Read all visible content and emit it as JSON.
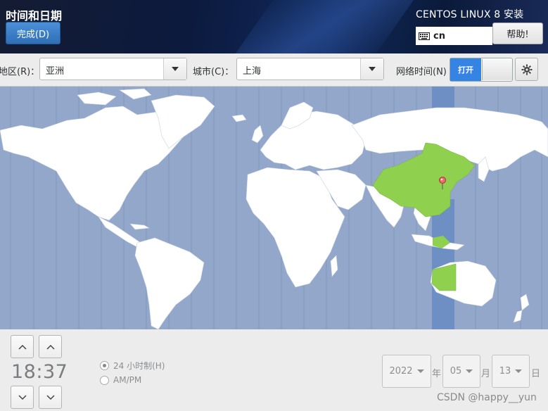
{
  "header": {
    "title": "时间和日期",
    "done_button": "完成(D)",
    "product": "CENTOS LINUX 8 安装",
    "keyboard_layout": "cn",
    "help_button": "帮助!"
  },
  "toolbar": {
    "region_label": "地区(R)：",
    "region_value": "亚洲",
    "city_label": "城市(C)：",
    "city_value": "上海",
    "ntp_label": "网络时间(N)",
    "ntp_toggle_label": "打开",
    "ntp_enabled": true
  },
  "map": {
    "ocean_color": "#92a7c9",
    "land_color": "#ffffff",
    "selected_timezone_color": "#8fd14f",
    "selected_band_color": "#6e8fc4",
    "selected_city": "上海"
  },
  "clock": {
    "time": "18:37",
    "format_24h": "24 小时制(H)",
    "format_ampm": "AM/PM",
    "selected_format": "24h"
  },
  "date": {
    "year": "2022",
    "year_unit": "年",
    "month": "05",
    "month_unit": "月",
    "day": "13",
    "day_unit": "日"
  },
  "watermark": "CSDN @happy__yun"
}
